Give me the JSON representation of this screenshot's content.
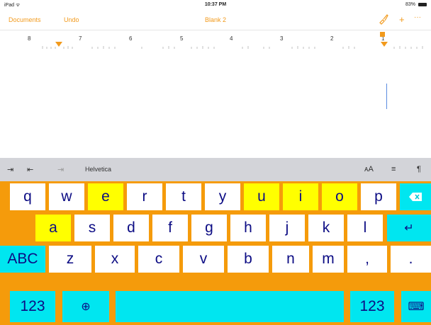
{
  "status_bar": {
    "left": "iPad ᯤ",
    "time": "10:37 PM",
    "battery": "83%"
  },
  "nav": {
    "documents": "Documents",
    "undo": "Undo",
    "title": "Blank 2",
    "plus": "+",
    "more": "···"
  },
  "ruler": {
    "numbers": [
      "8",
      "7",
      "6",
      "5",
      "4",
      "3",
      "2",
      "1"
    ]
  },
  "format_bar": {
    "indent": "⇥",
    "align_left": "⇤",
    "align_right": "⇥",
    "font": "Helvetica",
    "text_size": "ᴀA",
    "align": "≡",
    "paragraph": "¶"
  },
  "keyboard": {
    "row1": [
      "q",
      "w",
      "e",
      "r",
      "t",
      "y",
      "u",
      "i",
      "o",
      "p"
    ],
    "row2": [
      "a",
      "s",
      "d",
      "f",
      "g",
      "h",
      "j",
      "k",
      "l"
    ],
    "row3": [
      "ABC",
      "z",
      "x",
      "c",
      "v",
      "b",
      "n",
      "m",
      ",",
      "."
    ],
    "row4": {
      "numbers_left": "123",
      "globe": "⊕",
      "numbers_right": "123",
      "dismiss": "⌨"
    },
    "delete": "⌫",
    "return": "↵",
    "colors": {
      "background": "#f59b0b",
      "highlight": "#ffff00",
      "accent": "#00e6f0",
      "letters": "#0c0c84"
    }
  }
}
